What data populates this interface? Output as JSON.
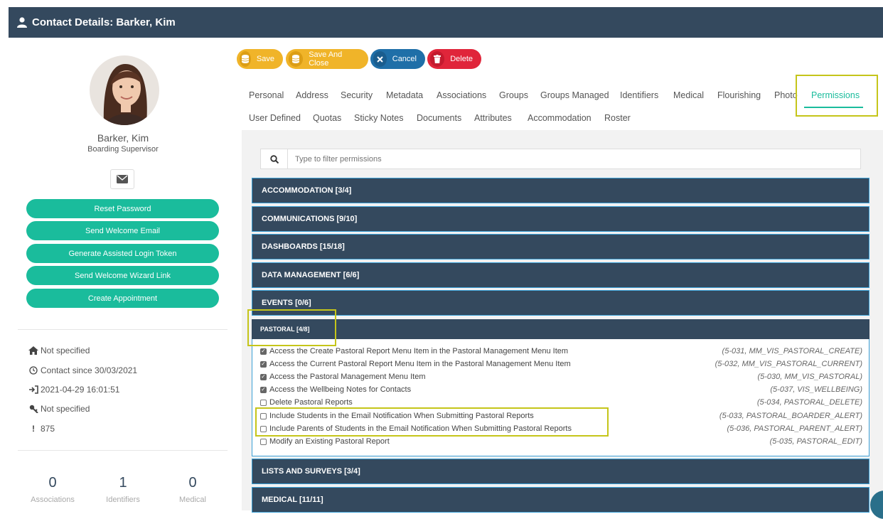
{
  "header": {
    "title": "Contact Details: Barker, Kim"
  },
  "profile": {
    "name": "Barker, Kim",
    "role": "Boarding Supervisor",
    "buttons": [
      "Reset Password",
      "Send Welcome Email",
      "Generate Assisted Login Token",
      "Send Welcome Wizard Link",
      "Create Appointment"
    ],
    "info": {
      "address": "Not specified",
      "contact_since": "Contact since 30/03/2021",
      "last_login": "2021-04-29 16:01:51",
      "password": "Not specified",
      "id": "875"
    },
    "stats": [
      {
        "value": "0",
        "label": "Associations"
      },
      {
        "value": "1",
        "label": "Identifiers"
      },
      {
        "value": "0",
        "label": "Medical"
      }
    ]
  },
  "toolbar": {
    "save": "Save",
    "save_close": "Save And Close",
    "cancel": "Cancel",
    "delete": "Delete"
  },
  "tabs": {
    "row1": [
      "Personal",
      "Address",
      "Security",
      "Metadata",
      "Associations",
      "Groups",
      "Groups Managed",
      "Identifiers",
      "Medical",
      "Flourishing",
      "Photo",
      "Permissions"
    ],
    "row2": [
      "User Defined",
      "Quotas",
      "Sticky Notes",
      "Documents",
      "Attributes",
      "Accommodation",
      "Roster"
    ],
    "active": "Permissions"
  },
  "filter": {
    "placeholder": "Type to filter permissions"
  },
  "groups": {
    "before": [
      "ACCOMMODATION [3/4]",
      "COMMUNICATIONS [9/10]",
      "DASHBOARDS [15/18]",
      "DATA MANAGEMENT [6/6]",
      "EVENTS [0/6]"
    ],
    "pastoral": {
      "title": "PASTORAL [4/8]",
      "items": [
        {
          "label": "Access the Create Pastoral Report Menu Item in the Pastoral Management Menu Item",
          "code": "(5-031, MM_VIS_PASTORAL_CREATE)",
          "checked": true
        },
        {
          "label": "Access the Current Pastoral Report Menu Item in the Pastoral Management Menu Item",
          "code": "(5-032, MM_VIS_PASTORAL_CURRENT)",
          "checked": true
        },
        {
          "label": "Access the Pastoral Management Menu Item",
          "code": "(5-030, MM_VIS_PASTORAL)",
          "checked": true
        },
        {
          "label": "Access the Wellbeing Notes for Contacts",
          "code": "(5-037, VIS_WELLBEING)",
          "checked": true
        },
        {
          "label": "Delete Pastoral Reports",
          "code": "(5-034, PASTORAL_DELETE)",
          "checked": false
        },
        {
          "label": "Include Students in the Email Notification When Submitting Pastoral Reports",
          "code": "(5-033, PASTORAL_BOARDER_ALERT)",
          "checked": false
        },
        {
          "label": "Include Parents of Students in the Email Notification When Submitting Pastoral Reports",
          "code": "(5-036, PASTORAL_PARENT_ALERT)",
          "checked": false
        },
        {
          "label": "Modify an Existing Pastoral Report",
          "code": "(5-035, PASTORAL_EDIT)",
          "checked": false
        }
      ]
    },
    "after": [
      "LISTS AND SURVEYS [3/4]",
      "MEDICAL [11/11]"
    ]
  },
  "colors": {
    "header": "#34495e",
    "accent": "#1abc9c",
    "save": "#f0b429",
    "cancel": "#1f6fa8",
    "delete": "#e0253a",
    "highlight": "#c5c51a"
  }
}
